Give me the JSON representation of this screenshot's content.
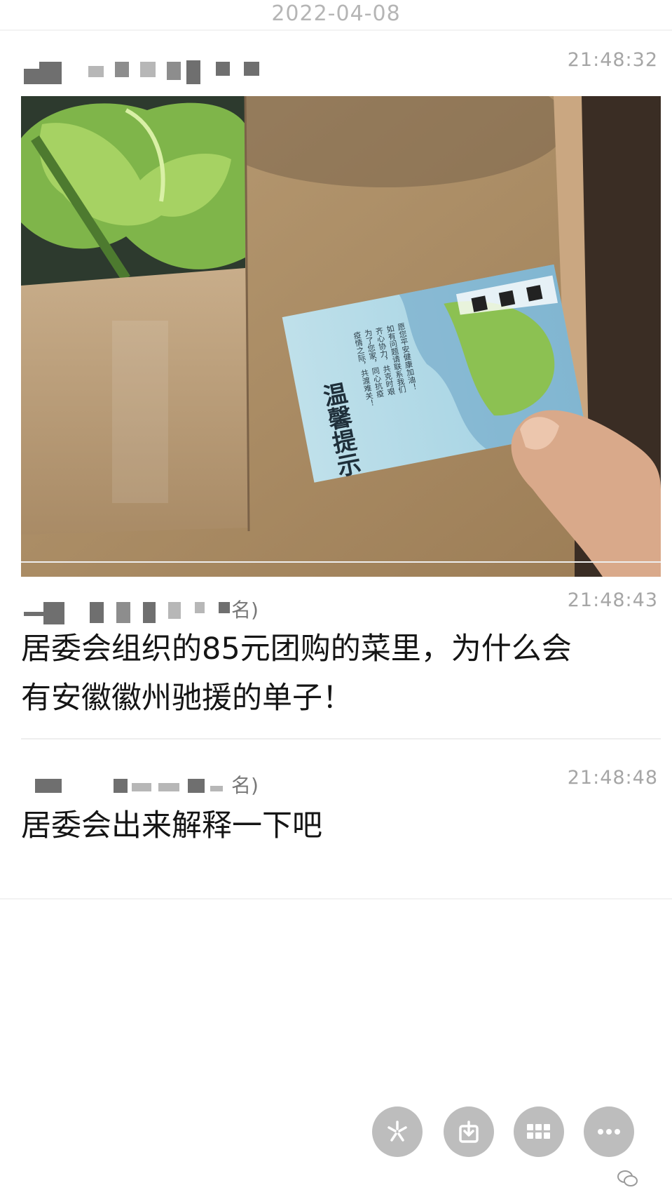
{
  "header": {
    "date": "2022-04-08"
  },
  "messages": [
    {
      "sender_suffix": "",
      "time": "21:48:32",
      "image": {
        "card_title": "温馨提示",
        "card_body": "疫情之际，共渡难关！为了您家，同心抗疫，齐心协力，共克时艰。如有问题请联系我们。愿您平安健康，我们在一起加油！"
      }
    },
    {
      "sender_suffix": "名)",
      "time": "21:48:43",
      "text_line1": "居委会组织的85元团购的菜里，为什么会",
      "text_line2": "有安徽徽州驰援的单子！"
    },
    {
      "sender_suffix": "名)",
      "time": "21:48:48",
      "text": "居委会出来解释一下吧"
    }
  ],
  "toolbar": {
    "buttons": [
      {
        "name": "share-icon"
      },
      {
        "name": "save-icon"
      },
      {
        "name": "grid-icon"
      },
      {
        "name": "more-icon"
      }
    ]
  },
  "colors": {
    "button_bg": "#bdbdbd",
    "text": "#151515",
    "muted": "#a6a6a6"
  }
}
